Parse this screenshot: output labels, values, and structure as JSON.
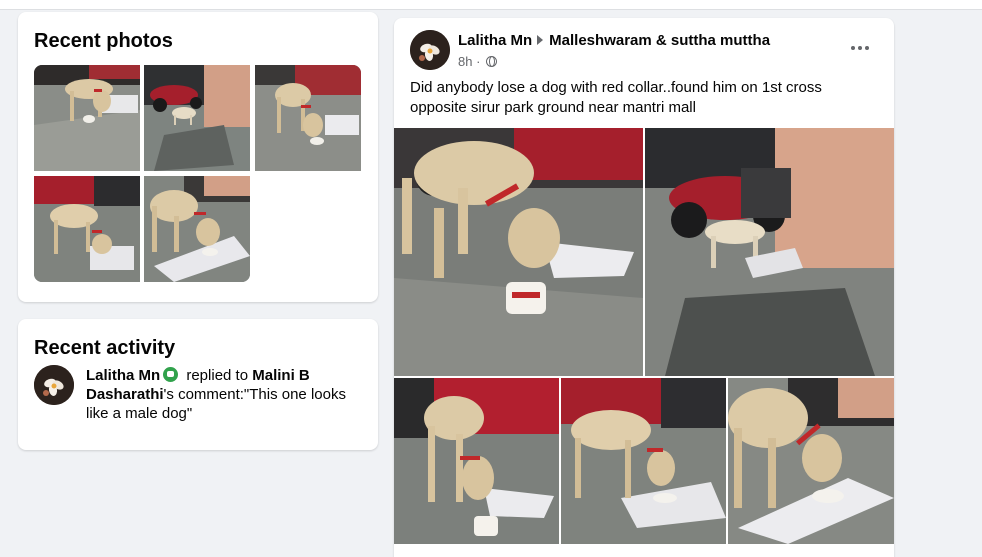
{
  "recent_photos": {
    "title": "Recent photos",
    "thumbnails": [
      {
        "icon": "dog-photo"
      },
      {
        "icon": "dog-photo"
      },
      {
        "icon": "dog-photo"
      },
      {
        "icon": "dog-photo"
      },
      {
        "icon": "dog-photo"
      }
    ]
  },
  "recent_activity": {
    "title": "Recent activity",
    "actor": "Lalitha Mn",
    "action": "replied to",
    "target_first": "Malini B",
    "target_last": "Dasharathi",
    "suffix": "'s comment:\"This one looks like a male dog\""
  },
  "post": {
    "author": "Lalitha Mn",
    "group": "Malleshwaram & suttha muttha",
    "time": "8h ·",
    "text": "Did anybody lose a dog with red collar..found him on 1st cross opposite sirur park ground near mantri mall",
    "media_count": 5
  },
  "colors": {
    "page_bg": "#f0f2f5",
    "card_bg": "#ffffff",
    "secondary_text": "#65676b",
    "online_green": "#31a24c",
    "collar_red": "#c0282a"
  }
}
